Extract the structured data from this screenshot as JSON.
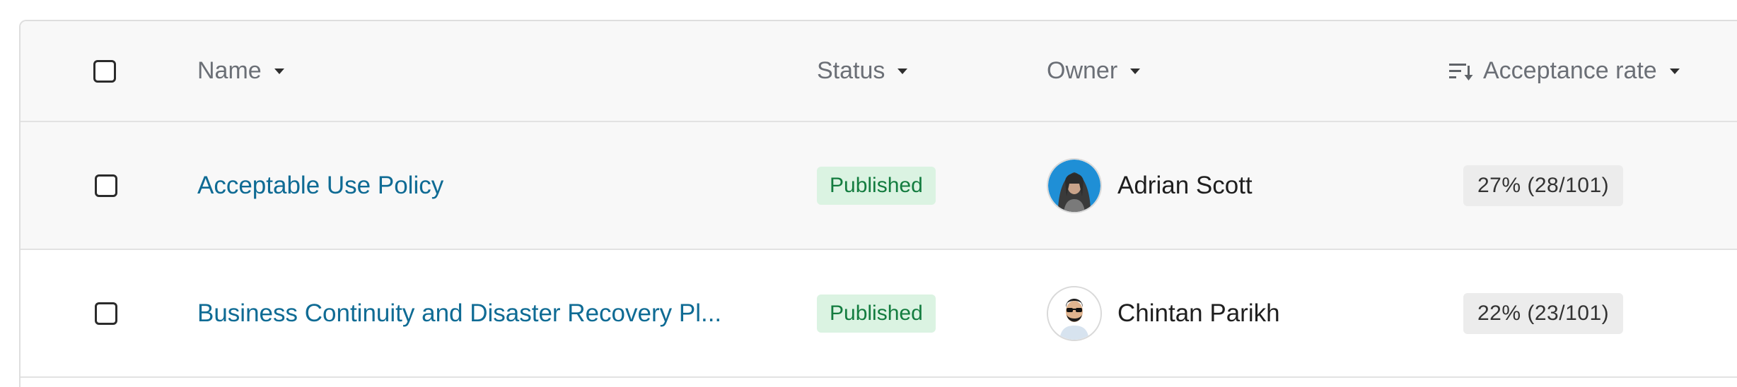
{
  "table": {
    "headers": {
      "name": "Name",
      "status": "Status",
      "owner": "Owner",
      "acceptance_rate": "Acceptance rate"
    },
    "rows": [
      {
        "name": "Acceptable Use Policy",
        "status": "Published",
        "owner": "Adrian Scott",
        "acceptance_rate": "27% (28/101)"
      },
      {
        "name": "Business Continuity and Disaster Recovery Pl...",
        "status": "Published",
        "owner": "Chintan Parikh",
        "acceptance_rate": "22% (23/101)"
      }
    ]
  },
  "colors": {
    "link": "#0f6b94",
    "badge_bg": "#dbf3e2",
    "badge_text": "#137c3f",
    "rate_bg": "#ececec"
  },
  "icons": {
    "sort": "sort-descending-icon",
    "caret": "caret-down-icon"
  }
}
